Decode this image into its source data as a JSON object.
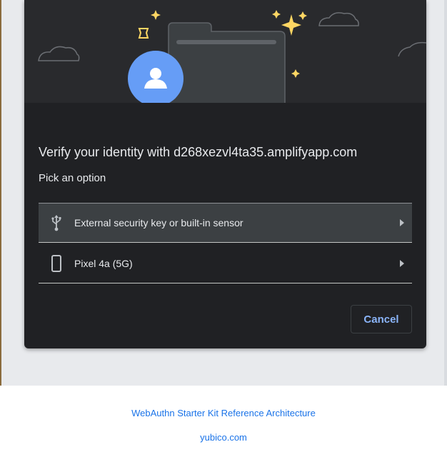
{
  "dialog": {
    "title": "Verify your identity with d268xezvl4ta35.amplifyapp.com",
    "subtitle": "Pick an option",
    "options": [
      {
        "label": "External security key or built-in sensor",
        "icon": "usb-icon"
      },
      {
        "label": "Pixel 4a (5G)",
        "icon": "phone-icon"
      }
    ],
    "cancel_label": "Cancel"
  },
  "footer": {
    "link1": "WebAuthn Starter Kit Reference Architecture",
    "link2": "yubico.com"
  },
  "colors": {
    "accent": "#8ab4f8",
    "link": "#1a73e8",
    "dialog_bg": "#202124",
    "header_bg": "#292a2d",
    "selected_row": "#3c4043",
    "avatar": "#669df6",
    "sparkle": "#fdd663"
  }
}
